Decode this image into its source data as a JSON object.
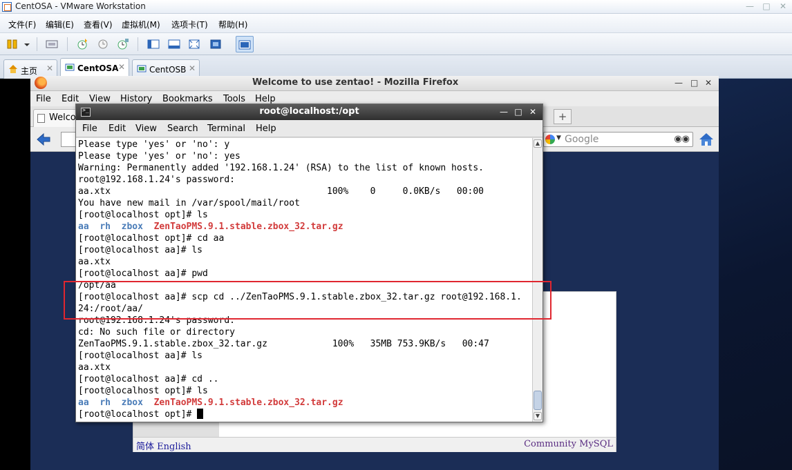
{
  "vmware": {
    "title": "CentOSA - VMware Workstation",
    "menu": [
      "文件(F)",
      "编辑(E)",
      "查看(V)",
      "虚拟机(M)",
      "选项卡(T)",
      "帮助(H)"
    ],
    "tabs": [
      {
        "label": "主页",
        "active": false
      },
      {
        "label": "CentOSA",
        "active": true
      },
      {
        "label": "CentOSB",
        "active": false
      }
    ],
    "accent": "#2c66b8"
  },
  "firefox": {
    "title": "Welcome to use zentao! - Mozilla Firefox",
    "menu": [
      "File",
      "Edit",
      "View",
      "History",
      "Bookmarks",
      "Tools",
      "Help"
    ],
    "tab_label": "Welco",
    "search_placeholder": "Google",
    "page": {
      "lang_links": "简体 English",
      "community": "Community MySQL"
    }
  },
  "terminal": {
    "title": "root@localhost:/opt",
    "menu": [
      "File",
      "Edit",
      "View",
      "Search",
      "Terminal",
      "Help"
    ],
    "lines": [
      {
        "text": "Please type 'yes' or 'no': y"
      },
      {
        "text": "Please type 'yes' or 'no': yes"
      },
      {
        "text": "Warning: Permanently added '192.168.1.24' (RSA) to the list of known hosts."
      },
      {
        "text": "root@192.168.1.24's password:"
      },
      {
        "text": "aa.xtx                                        100%    0     0.0KB/s   00:00"
      },
      {
        "text": "You have new mail in /var/spool/mail/root"
      },
      {
        "text": "[root@localhost opt]# ls"
      },
      {
        "segments": [
          {
            "t": "aa",
            "c": "dir"
          },
          {
            "t": "  "
          },
          {
            "t": "rh",
            "c": "dir"
          },
          {
            "t": "  "
          },
          {
            "t": "zbox",
            "c": "dir"
          },
          {
            "t": "  "
          },
          {
            "t": "ZenTaoPMS.9.1.stable.zbox_32.tar.gz",
            "c": "arc"
          }
        ]
      },
      {
        "text": "[root@localhost opt]# cd aa"
      },
      {
        "text": "[root@localhost aa]# ls"
      },
      {
        "text": "aa.xtx"
      },
      {
        "text": "[root@localhost aa]# pwd"
      },
      {
        "text": "/opt/aa"
      },
      {
        "text": "[root@localhost aa]# scp cd ../ZenTaoPMS.9.1.stable.zbox_32.tar.gz root@192.168.1."
      },
      {
        "text": "24:/root/aa/"
      },
      {
        "text": "root@192.168.1.24's password:"
      },
      {
        "text": "cd: No such file or directory"
      },
      {
        "text": "ZenTaoPMS.9.1.stable.zbox_32.tar.gz            100%   35MB 753.9KB/s   00:47"
      },
      {
        "text": "[root@localhost aa]# ls"
      },
      {
        "text": "aa.xtx"
      },
      {
        "text": "[root@localhost aa]# cd .."
      },
      {
        "text": "[root@localhost opt]# ls"
      },
      {
        "segments": [
          {
            "t": "aa",
            "c": "dir"
          },
          {
            "t": "  "
          },
          {
            "t": "rh",
            "c": "dir"
          },
          {
            "t": "  "
          },
          {
            "t": "zbox",
            "c": "dir"
          },
          {
            "t": "  "
          },
          {
            "t": "ZenTaoPMS.9.1.stable.zbox_32.tar.gz",
            "c": "arc"
          }
        ]
      },
      {
        "text": "[root@localhost opt]# ",
        "cursor": true
      }
    ],
    "colors": {
      "dir": "#4a7cb8",
      "archive": "#d23b3b",
      "highlight": "#e0262f"
    }
  }
}
